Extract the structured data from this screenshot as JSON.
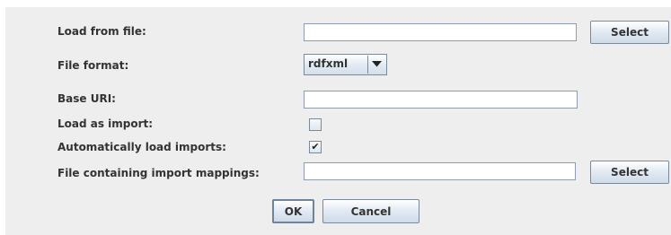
{
  "form": {
    "load_from_file": {
      "label": "Load from file:",
      "value": "",
      "button": "Select"
    },
    "file_format": {
      "label": "File format:",
      "selected": "rdfxml"
    },
    "base_uri": {
      "label": "Base URI:",
      "value": ""
    },
    "load_as_import": {
      "label": "Load as import:",
      "checked": false
    },
    "auto_load_imports": {
      "label": "Automatically load imports:",
      "checked": true,
      "mark": "✔"
    },
    "import_mappings": {
      "label": "File containing import mappings:",
      "value": "",
      "button": "Select"
    }
  },
  "actions": {
    "ok": "OK",
    "cancel": "Cancel"
  },
  "colors": {
    "panel_bg": "#eeeeee",
    "field_border": "#8d9cb0",
    "button_border": "#7a8a99"
  },
  "icons": {
    "combo_arrow": "chevron-down-icon",
    "check_mark": "check-icon"
  }
}
